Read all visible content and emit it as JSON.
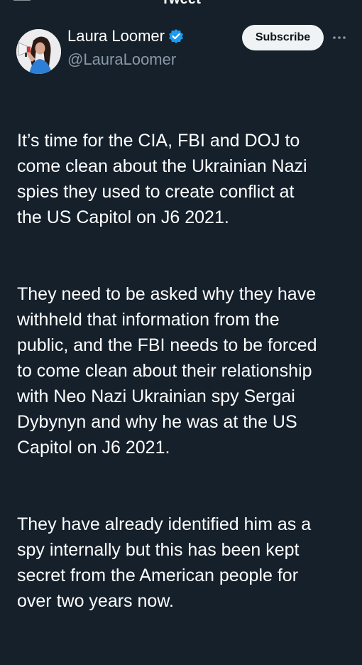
{
  "header": {
    "title": "Tweet",
    "back_icon": "back-arrow-icon"
  },
  "author": {
    "name": "Laura Loomer",
    "handle": "@LauraLoomer",
    "verified": true,
    "verified_color": "#1d9bf0"
  },
  "actions": {
    "subscribe_label": "Subscribe",
    "more_icon": "more-options-icon"
  },
  "tweet": {
    "paragraphs": [
      "It’s time for the CIA, FBI and DOJ to\ncome clean about the Ukrainian Nazi\nspies they used to create conflict at\nthe US Capitol on J6 2021.",
      "They need to be asked why they have\nwithheld that information from the\npublic, and the FBI needs to be forced\nto come clean about their relationship\nwith Neo Nazi Ukrainian spy Sergai\nDybynyn and why he was at the US\nCapitol on J6 2021.",
      "They have already identified him as a\nspy internally but this has been kept\nsecret from the American people for\nover two years now."
    ]
  },
  "theme": {
    "background": "#15202b",
    "text": "#ffffff",
    "secondary_text": "#8b98a5"
  }
}
